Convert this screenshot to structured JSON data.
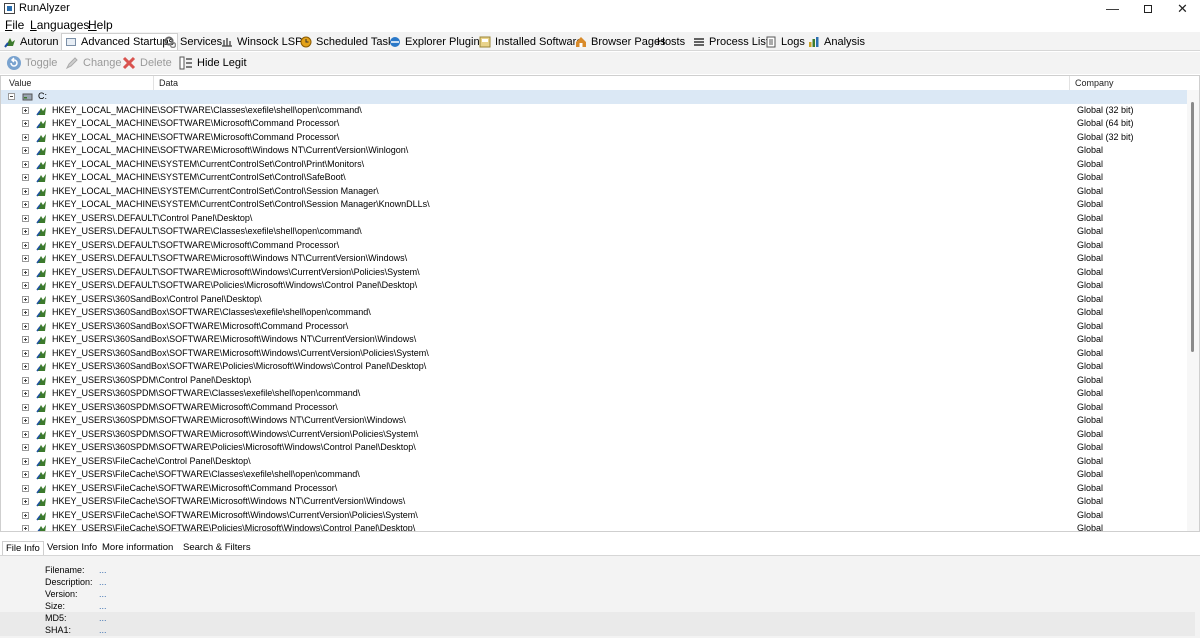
{
  "window": {
    "title": "RunAlyzer",
    "min_glyph": "—",
    "close_glyph": "✕"
  },
  "menu": [
    {
      "label": "File",
      "mnemonic": "F",
      "rest": "ile"
    },
    {
      "label": "Languages",
      "mnemonic": "L",
      "rest": "anguages"
    },
    {
      "label": "Help",
      "mnemonic": "H",
      "rest": "elp"
    }
  ],
  "tabs": [
    {
      "label": "Autorun",
      "icon": "autorun-icon",
      "active": false
    },
    {
      "label": "Advanced Startups",
      "icon": "advanced-startups-icon",
      "active": true
    },
    {
      "label": "Services",
      "icon": "services-icon",
      "active": false
    },
    {
      "label": "Winsock LSPs",
      "icon": "winsock-icon",
      "active": false
    },
    {
      "label": "Scheduled Tasks",
      "icon": "scheduled-tasks-icon",
      "active": false
    },
    {
      "label": "Explorer Plugins",
      "icon": "explorer-plugins-icon",
      "active": false
    },
    {
      "label": "Installed Software",
      "icon": "installed-software-icon",
      "active": false
    },
    {
      "label": "Browser Pages",
      "icon": "browser-pages-icon",
      "active": false
    },
    {
      "label": "Hosts",
      "icon": "",
      "active": false
    },
    {
      "label": "Process List",
      "icon": "process-list-icon",
      "active": false
    },
    {
      "label": "Logs",
      "icon": "logs-icon",
      "active": false
    },
    {
      "label": "Analysis",
      "icon": "analysis-icon",
      "active": false
    }
  ],
  "toolbar": {
    "toggle": "Toggle",
    "change": "Change",
    "delete": "Delete",
    "hide_legit": "Hide Legit"
  },
  "columns": {
    "value": "Value",
    "data": "Data",
    "company": "Company"
  },
  "group": {
    "label": "C:"
  },
  "rows": [
    {
      "path": "HKEY_LOCAL_MACHINE\\SOFTWARE\\Classes\\exefile\\shell\\open\\command\\",
      "company": "Global (32 bit)"
    },
    {
      "path": "HKEY_LOCAL_MACHINE\\SOFTWARE\\Microsoft\\Command Processor\\",
      "company": "Global (64 bit)"
    },
    {
      "path": "HKEY_LOCAL_MACHINE\\SOFTWARE\\Microsoft\\Command Processor\\",
      "company": "Global (32 bit)"
    },
    {
      "path": "HKEY_LOCAL_MACHINE\\SOFTWARE\\Microsoft\\Windows NT\\CurrentVersion\\Winlogon\\",
      "company": "Global"
    },
    {
      "path": "HKEY_LOCAL_MACHINE\\SYSTEM\\CurrentControlSet\\Control\\Print\\Monitors\\",
      "company": "Global"
    },
    {
      "path": "HKEY_LOCAL_MACHINE\\SYSTEM\\CurrentControlSet\\Control\\SafeBoot\\",
      "company": "Global"
    },
    {
      "path": "HKEY_LOCAL_MACHINE\\SYSTEM\\CurrentControlSet\\Control\\Session Manager\\",
      "company": "Global"
    },
    {
      "path": "HKEY_LOCAL_MACHINE\\SYSTEM\\CurrentControlSet\\Control\\Session Manager\\KnownDLLs\\",
      "company": "Global"
    },
    {
      "path": "HKEY_USERS\\.DEFAULT\\Control Panel\\Desktop\\",
      "company": "Global"
    },
    {
      "path": "HKEY_USERS\\.DEFAULT\\SOFTWARE\\Classes\\exefile\\shell\\open\\command\\",
      "company": "Global"
    },
    {
      "path": "HKEY_USERS\\.DEFAULT\\SOFTWARE\\Microsoft\\Command Processor\\",
      "company": "Global"
    },
    {
      "path": "HKEY_USERS\\.DEFAULT\\SOFTWARE\\Microsoft\\Windows NT\\CurrentVersion\\Windows\\",
      "company": "Global"
    },
    {
      "path": "HKEY_USERS\\.DEFAULT\\SOFTWARE\\Microsoft\\Windows\\CurrentVersion\\Policies\\System\\",
      "company": "Global"
    },
    {
      "path": "HKEY_USERS\\.DEFAULT\\SOFTWARE\\Policies\\Microsoft\\Windows\\Control Panel\\Desktop\\",
      "company": "Global"
    },
    {
      "path": "HKEY_USERS\\360SandBox\\Control Panel\\Desktop\\",
      "company": "Global"
    },
    {
      "path": "HKEY_USERS\\360SandBox\\SOFTWARE\\Classes\\exefile\\shell\\open\\command\\",
      "company": "Global"
    },
    {
      "path": "HKEY_USERS\\360SandBox\\SOFTWARE\\Microsoft\\Command Processor\\",
      "company": "Global"
    },
    {
      "path": "HKEY_USERS\\360SandBox\\SOFTWARE\\Microsoft\\Windows NT\\CurrentVersion\\Windows\\",
      "company": "Global"
    },
    {
      "path": "HKEY_USERS\\360SandBox\\SOFTWARE\\Microsoft\\Windows\\CurrentVersion\\Policies\\System\\",
      "company": "Global"
    },
    {
      "path": "HKEY_USERS\\360SandBox\\SOFTWARE\\Policies\\Microsoft\\Windows\\Control Panel\\Desktop\\",
      "company": "Global"
    },
    {
      "path": "HKEY_USERS\\360SPDM\\Control Panel\\Desktop\\",
      "company": "Global"
    },
    {
      "path": "HKEY_USERS\\360SPDM\\SOFTWARE\\Classes\\exefile\\shell\\open\\command\\",
      "company": "Global"
    },
    {
      "path": "HKEY_USERS\\360SPDM\\SOFTWARE\\Microsoft\\Command Processor\\",
      "company": "Global"
    },
    {
      "path": "HKEY_USERS\\360SPDM\\SOFTWARE\\Microsoft\\Windows NT\\CurrentVersion\\Windows\\",
      "company": "Global"
    },
    {
      "path": "HKEY_USERS\\360SPDM\\SOFTWARE\\Microsoft\\Windows\\CurrentVersion\\Policies\\System\\",
      "company": "Global"
    },
    {
      "path": "HKEY_USERS\\360SPDM\\SOFTWARE\\Policies\\Microsoft\\Windows\\Control Panel\\Desktop\\",
      "company": "Global"
    },
    {
      "path": "HKEY_USERS\\FileCache\\Control Panel\\Desktop\\",
      "company": "Global"
    },
    {
      "path": "HKEY_USERS\\FileCache\\SOFTWARE\\Classes\\exefile\\shell\\open\\command\\",
      "company": "Global"
    },
    {
      "path": "HKEY_USERS\\FileCache\\SOFTWARE\\Microsoft\\Command Processor\\",
      "company": "Global"
    },
    {
      "path": "HKEY_USERS\\FileCache\\SOFTWARE\\Microsoft\\Windows NT\\CurrentVersion\\Windows\\",
      "company": "Global"
    },
    {
      "path": "HKEY_USERS\\FileCache\\SOFTWARE\\Microsoft\\Windows\\CurrentVersion\\Policies\\System\\",
      "company": "Global"
    },
    {
      "path": "HKEY_USERS\\FileCache\\SOFTWARE\\Policies\\Microsoft\\Windows\\Control Panel\\Desktop\\",
      "company": "Global"
    }
  ],
  "bottom_tabs": [
    {
      "label": "File Info",
      "active": true
    },
    {
      "label": "Version Info",
      "active": false
    },
    {
      "label": "More information",
      "active": false
    },
    {
      "label": "Search & Filters",
      "active": false
    }
  ],
  "file_info": [
    {
      "label": "Filename:",
      "value": "..."
    },
    {
      "label": "Description:",
      "value": "..."
    },
    {
      "label": "Version:",
      "value": "..."
    },
    {
      "label": "Size:",
      "value": "..."
    },
    {
      "label": "MD5:",
      "value": "..."
    },
    {
      "label": "SHA1:",
      "value": "..."
    }
  ],
  "colors": {
    "accent": "#2a6fb0",
    "selection": "#dbe8f5",
    "value_link": "#3a6fb0"
  }
}
